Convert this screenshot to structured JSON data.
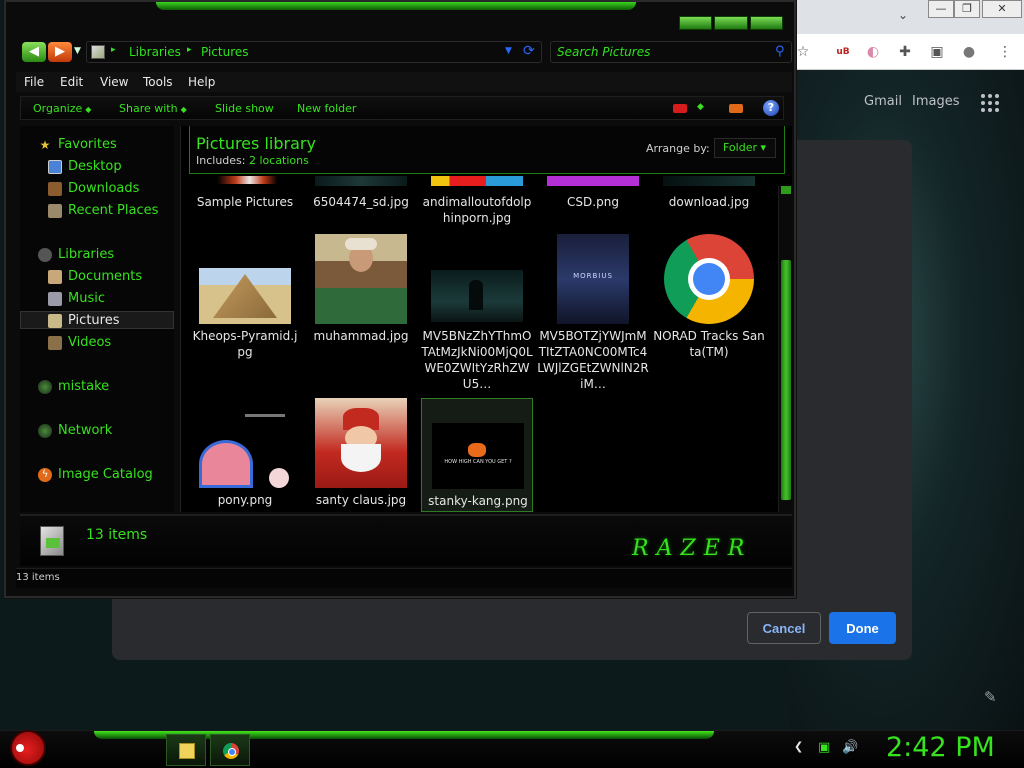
{
  "browser": {
    "ctrl_min": "—",
    "ctrl_max": "❐",
    "ctrl_close": "✕",
    "chevron": "⌄",
    "links": {
      "gmail": "Gmail",
      "images": "Images"
    },
    "toolbar_icons": [
      "star-icon",
      "ublock-icon",
      "flag-icon",
      "puzzle-icon",
      "sidepanel-icon",
      "profile-icon",
      "menu-icon"
    ],
    "star_glyph": "☆",
    "ub_glyph": "uB",
    "flag_glyph": "◐",
    "puzzle_glyph": "✚",
    "panel_glyph": "▣",
    "profile_glyph": "●",
    "menu_glyph": "⋮",
    "dialog": {
      "cancel_label": "Cancel",
      "done_label": "Done"
    },
    "pencil_glyph": "✎"
  },
  "explorer": {
    "nav": {
      "back_glyph": "◀",
      "fwd_glyph": "▶",
      "drop_glyph": "▼",
      "crumbs": [
        "Libraries",
        "Pictures"
      ],
      "crumb_sep": "▸",
      "refresh_glyph": "⟳",
      "search_placeholder": "Search Pictures",
      "search_glyph": "⚲"
    },
    "menu": [
      "File",
      "Edit",
      "View",
      "Tools",
      "Help"
    ],
    "commands": [
      "Organize",
      "Share with",
      "Slide show",
      "New folder"
    ],
    "command_dot": "◆",
    "help_glyph": "?",
    "sidebar": {
      "favorites": "Favorites",
      "desktop": "Desktop",
      "downloads": "Downloads",
      "recent": "Recent Places",
      "libraries": "Libraries",
      "documents": "Documents",
      "music": "Music",
      "pictures": "Pictures",
      "videos": "Videos",
      "mistake": "mistake",
      "network": "Network",
      "catalog": "Image Catalog"
    },
    "library": {
      "title": "Pictures library",
      "includes_label": "Includes:",
      "includes_link": "2 locations",
      "arrange_label": "Arrange by:",
      "arrange_value": "Folder",
      "arrange_glyph": "▾"
    },
    "files": [
      {
        "name": "Sample Pictures"
      },
      {
        "name": "6504474_sd.jpg"
      },
      {
        "name": "andimalloutofdolphinporn.jpg"
      },
      {
        "name": "CSD.png"
      },
      {
        "name": "download.jpg"
      },
      {
        "name": "Kheops-Pyramid.jpg"
      },
      {
        "name": "muhammad.jpg"
      },
      {
        "name": "MV5BNzZhYThmOTAtMzJkNi00MjQ0LWE0ZWItYzRhZWU5…"
      },
      {
        "name": "MV5BOTZjYWJmMTItZTA0NC00MTc4LWJlZGEtZWNlN2RiM…"
      },
      {
        "name": "NORAD Tracks Santa(TM)"
      },
      {
        "name": "pony.png"
      },
      {
        "name": "santy claus.jpg"
      },
      {
        "name": "stanky-kang.png"
      }
    ],
    "thumb_text": {
      "morbius": "MORBIUS",
      "game": "HOW HIGH CAN YOU GET ?"
    },
    "details": {
      "count": "13 items",
      "logo": "RAZER"
    },
    "status": "13 items"
  },
  "taskbar": {
    "clock": "2:42 PM",
    "tray_glyphs": {
      "back": "❮",
      "net": "▣",
      "vol": "🔊"
    }
  },
  "colors": {
    "accent_green": "#37e21f",
    "chrome_blue": "#1a73e8",
    "link_blue": "#8ab4f8"
  }
}
